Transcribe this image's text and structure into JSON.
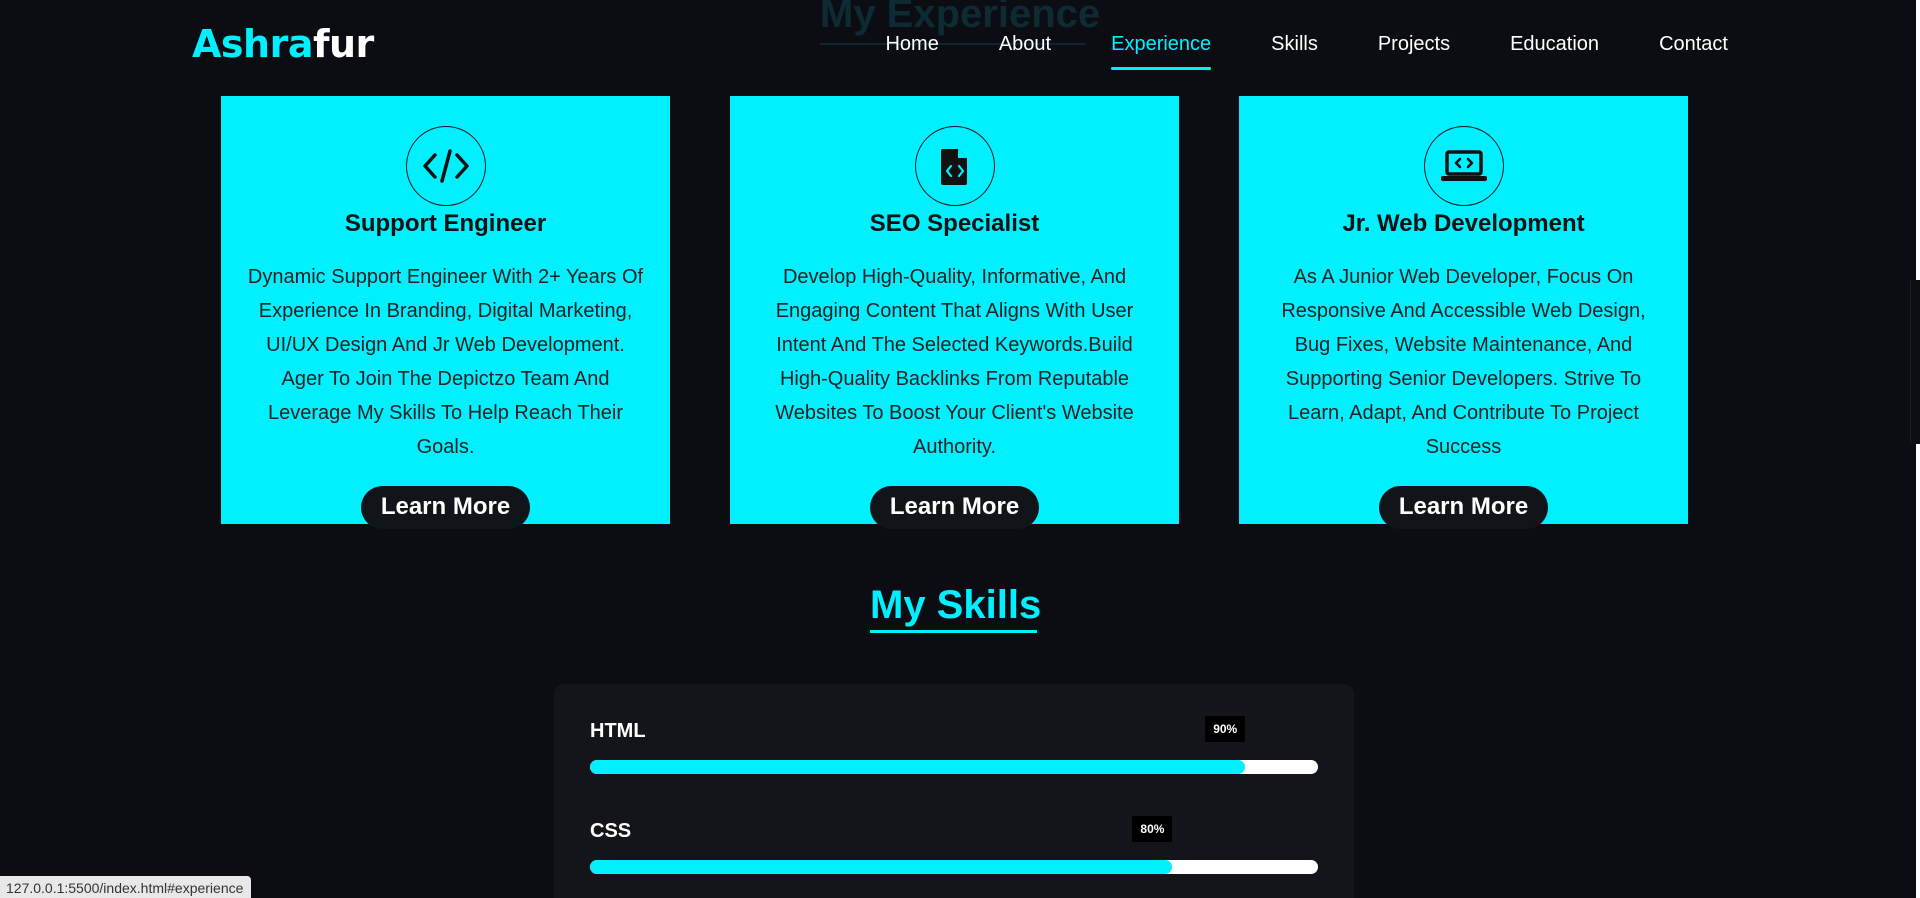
{
  "ghost_heading": "My Experience",
  "brand": {
    "accent": "Ashra",
    "rest": "fur"
  },
  "nav": [
    {
      "label": "Home",
      "active": false
    },
    {
      "label": "About",
      "active": false
    },
    {
      "label": "Experience",
      "active": true
    },
    {
      "label": "Skills",
      "active": false
    },
    {
      "label": "Projects",
      "active": false
    },
    {
      "label": "Education",
      "active": false
    },
    {
      "label": "Contact",
      "active": false
    }
  ],
  "cards": [
    {
      "icon": "code-icon",
      "title": "Support Engineer",
      "description": "Dynamic Support Engineer With 2+ Years Of Experience In Branding, Digital Marketing, UI/UX Design And Jr Web Development. Ager To Join The Depictzo Team And Leverage My Skills To Help Reach Their Goals.",
      "button": "Learn More"
    },
    {
      "icon": "file-code-icon",
      "title": "SEO Specialist",
      "description": "Develop High-Quality, Informative, And Engaging Content That Aligns With User Intent And The Selected Keywords.Build High-Quality Backlinks From Reputable Websites To Boost Your Client's Website Authority.",
      "button": "Learn More"
    },
    {
      "icon": "laptop-code-icon",
      "title": "Jr. Web Development",
      "description": "As A Junior Web Developer, Focus On Responsive And Accessible Web Design, Bug Fixes, Website Maintenance, And Supporting Senior Developers. Strive To Learn, Adapt, And Contribute To Project Success",
      "button": "Learn More"
    }
  ],
  "skills": {
    "title": "My Skills",
    "items": [
      {
        "name": "HTML",
        "percent_label": "90%",
        "level": 0.9
      },
      {
        "name": "CSS",
        "percent_label": "80%",
        "level": 0.8
      }
    ]
  },
  "status_bar": "127.0.0.1:5500/index.html#experience",
  "colors": {
    "accent": "#00f0ff",
    "background": "#0b0d12",
    "panel": "#13151b"
  }
}
